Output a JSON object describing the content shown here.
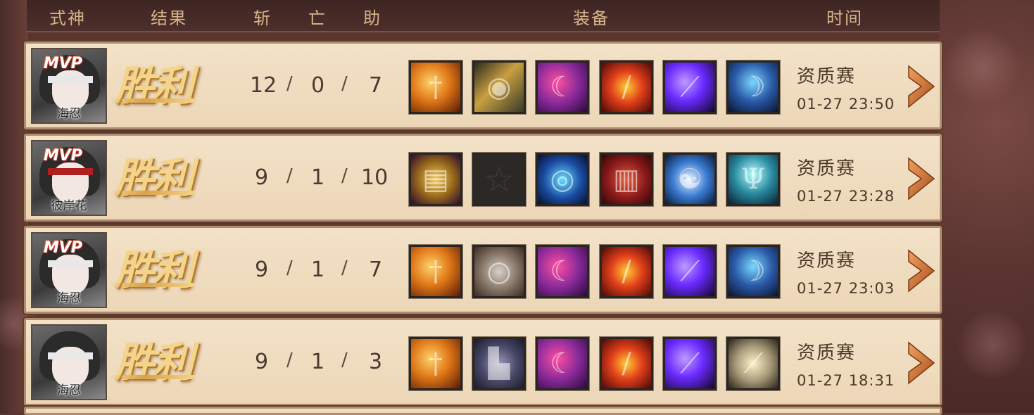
{
  "header": {
    "shikigami": "式神",
    "result": "结果",
    "kills": "斩",
    "deaths": "亡",
    "assists": "助",
    "equipment": "装备",
    "time": "时间"
  },
  "rows": [
    {
      "mvp": "MVP",
      "name": "海忍",
      "result": "胜利",
      "kills": "12",
      "deaths": "0",
      "assists": "7",
      "items": [
        "flame-dagger-icon",
        "golden-eye-blade-icon",
        "pink-scythe-icon",
        "fire-sword-icon",
        "violet-blade-icon",
        "blue-chain-scythe-icon"
      ],
      "mode": "资质赛",
      "time": "01-27 23:50"
    },
    {
      "mvp": "MVP",
      "name": "彼岸花",
      "result": "胜利",
      "kills": "9",
      "deaths": "1",
      "assists": "10",
      "items": [
        "golden-scroll-icon",
        "empty-slot-icon",
        "blue-staff-icon",
        "red-drum-icon",
        "bagua-mirror-icon",
        "ice-trident-icon"
      ],
      "mode": "资质赛",
      "time": "01-27 23:28"
    },
    {
      "mvp": "MVP",
      "name": "海忍",
      "result": "胜利",
      "kills": "9",
      "deaths": "1",
      "assists": "7",
      "items": [
        "flame-dagger-icon",
        "silver-ring-icon",
        "pink-scythe-icon",
        "fire-sword-icon",
        "violet-blade-icon",
        "blue-chain-scythe-icon"
      ],
      "mode": "资质赛",
      "time": "01-27 23:03"
    },
    {
      "mvp": "",
      "name": "海忍",
      "result": "胜利",
      "kills": "9",
      "deaths": "1",
      "assists": "3",
      "items": [
        "flame-dagger-icon",
        "ninja-boots-icon",
        "pink-scythe-icon",
        "fire-sword-icon",
        "violet-blade-icon",
        "white-katana-icon"
      ],
      "mode": "资质赛",
      "time": "01-27 18:31"
    }
  ],
  "separator": "/",
  "colors": {
    "row_bg": "#f3e2c8",
    "header_text": "#d7b48c",
    "result_gold": "#f4d48a",
    "arrow": "#c9702c"
  }
}
